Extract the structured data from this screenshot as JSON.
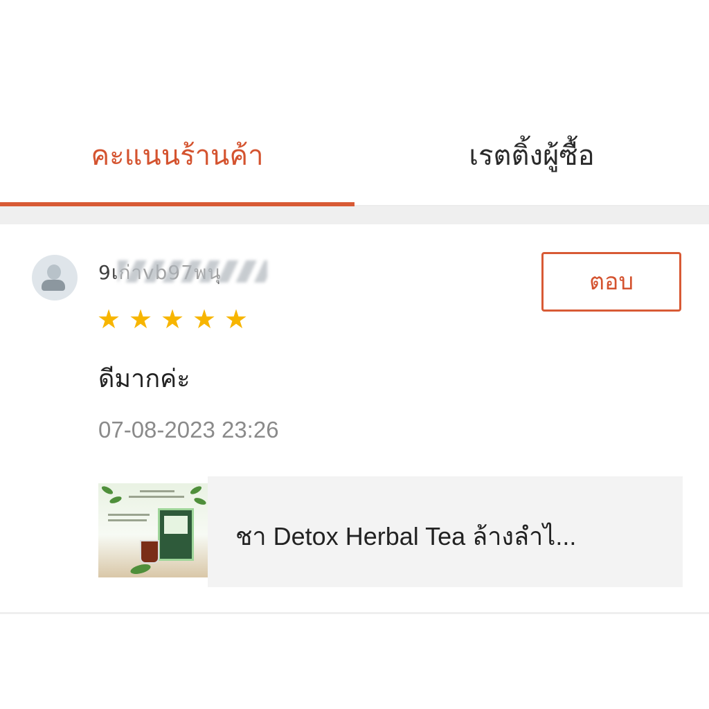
{
  "tabs": {
    "shop_rating": "คะแนนร้านค้า",
    "buyer_rating": "เรตติ้งผู้ซื้อ",
    "active": "shop_rating"
  },
  "colors": {
    "accent": "#d85a35",
    "star": "#f7b500",
    "product_bg": "#f3f3f3"
  },
  "review": {
    "username": "9เก่าvb97พนุ",
    "rating": 5,
    "stars": [
      "★",
      "★",
      "★",
      "★",
      "★"
    ],
    "comment": "ดีมากค่ะ",
    "timestamp": "07-08-2023 23:26",
    "reply_label": "ตอบ",
    "product": {
      "name": "ชา Detox Herbal Tea ล้างลำไ..."
    }
  }
}
